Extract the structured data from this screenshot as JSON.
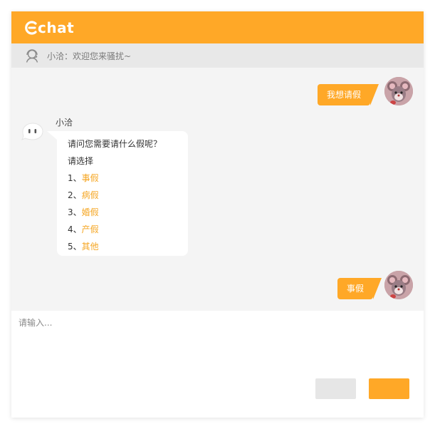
{
  "app": {
    "logo_text": "chat",
    "brand_color": "#ffa827",
    "link_color": "#f5a623"
  },
  "agent_bar": {
    "icon": "headset-agent-icon",
    "text": "小洽：欢迎您来骚扰~"
  },
  "messages": [
    {
      "from": "user",
      "text": "我想请假"
    },
    {
      "from": "bot",
      "name": "小洽",
      "question": "请问您需要请什么假呢？",
      "prompt": "请选择",
      "options": [
        {
          "num": "1、",
          "label": "事假"
        },
        {
          "num": "2、",
          "label": "病假"
        },
        {
          "num": "3、",
          "label": "婚假"
        },
        {
          "num": "4、",
          "label": "产假"
        },
        {
          "num": "5、",
          "label": "其他"
        }
      ]
    },
    {
      "from": "user",
      "text": "事假"
    }
  ],
  "input": {
    "placeholder": "请输入...",
    "value": "",
    "cancel_label": "",
    "send_label": ""
  }
}
